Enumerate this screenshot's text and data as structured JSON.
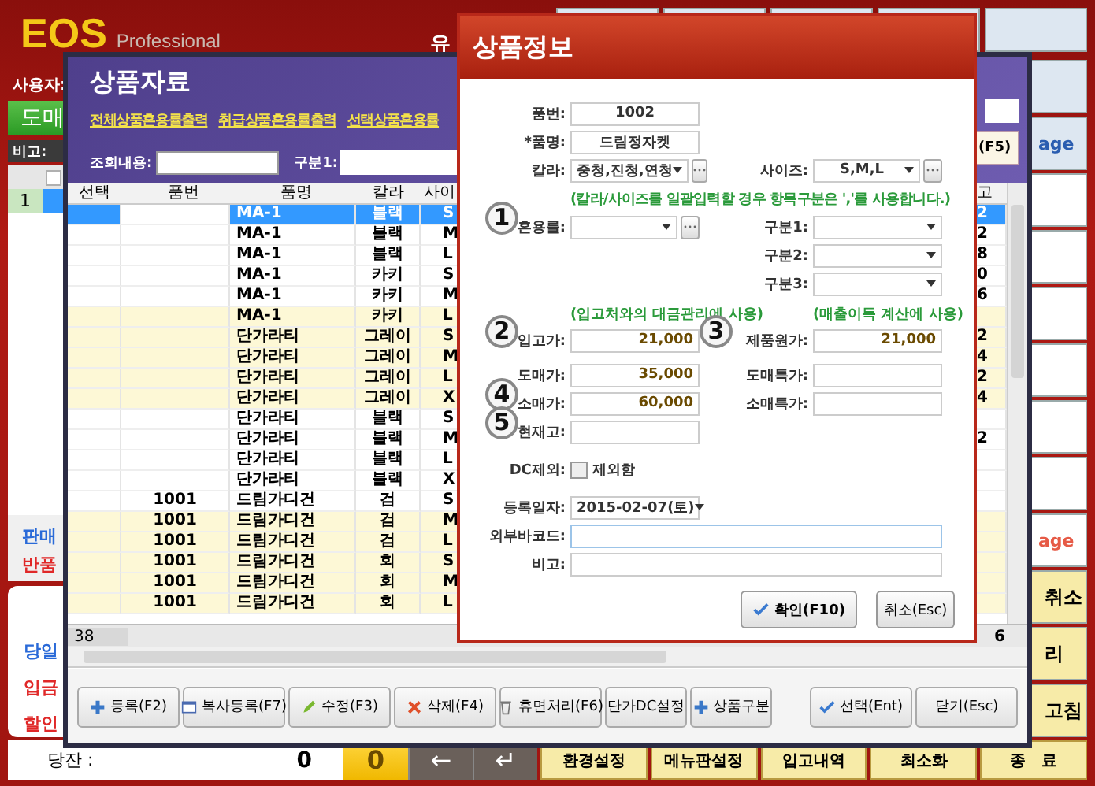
{
  "app": {
    "logo": "EOS",
    "edition": "Professional",
    "header_title": "유",
    "user_label": "사용자:",
    "mode_button": "도매",
    "memo_label": "비고:",
    "grid_row_number": "1",
    "sale_label": "판매",
    "return_label": "반품",
    "summary": [
      {
        "label": "당일",
        "color": "#2a6ad8"
      },
      {
        "label": "입금",
        "color": "#e02828"
      },
      {
        "label": "할인",
        "color": "#e02828"
      }
    ],
    "balance": {
      "label": "당잔 :",
      "value": "0"
    },
    "keypad": [
      {
        "label": "0",
        "kind": "number"
      },
      {
        "label": "←",
        "kind": "key"
      },
      {
        "label": "↵",
        "kind": "key"
      }
    ],
    "menu_buttons": [
      "환경설정",
      "메뉴판설정",
      "입고내역",
      "최소화",
      "종　료"
    ],
    "select_all_checked": false,
    "side_tiles": [
      {
        "kind": "nav"
      },
      {
        "kind": "nav",
        "label": "age",
        "color": "#2a5db0"
      },
      {
        "kind": "slot"
      },
      {
        "kind": "slot"
      },
      {
        "kind": "slot"
      },
      {
        "kind": "slot"
      },
      {
        "kind": "slot"
      },
      {
        "kind": "slot"
      },
      {
        "kind": "slot",
        "label": "age",
        "color": "#e65a46"
      },
      {
        "kind": "action",
        "label": "취소"
      },
      {
        "kind": "action",
        "label": "리"
      },
      {
        "kind": "action",
        "label": "고침"
      }
    ]
  },
  "product_list": {
    "title": "상품자료",
    "links": [
      "전체상품혼용률출력",
      "취급상품혼용률출력",
      "선택상품혼용률"
    ],
    "search_label": "조회내용:",
    "category_label": "구분1:",
    "search_button": "(F5)",
    "columns": [
      "선택",
      "품번",
      "품명",
      "칼라",
      "사이",
      "고"
    ],
    "rows": [
      {
        "name": "MA-1",
        "colorway": "블랙",
        "size": "S",
        "stock": "2",
        "selected": true,
        "highlight": false
      },
      {
        "name": "MA-1",
        "colorway": "블랙",
        "size": "M",
        "stock": "2",
        "selected": false,
        "highlight": false
      },
      {
        "name": "MA-1",
        "colorway": "블랙",
        "size": "L",
        "stock": "8",
        "selected": false,
        "highlight": false
      },
      {
        "name": "MA-1",
        "colorway": "카키",
        "size": "S",
        "stock": "0",
        "selected": false,
        "highlight": false
      },
      {
        "name": "MA-1",
        "colorway": "카키",
        "size": "M",
        "stock": "6",
        "selected": false,
        "highlight": false
      },
      {
        "name": "MA-1",
        "colorway": "카키",
        "size": "L",
        "selected": false,
        "highlight": true
      },
      {
        "name": "단가라티",
        "colorway": "그레이",
        "size": "S",
        "stock": "2",
        "selected": false,
        "highlight": true
      },
      {
        "name": "단가라티",
        "colorway": "그레이",
        "size": "M",
        "stock": "4",
        "selected": false,
        "highlight": true
      },
      {
        "name": "단가라티",
        "colorway": "그레이",
        "size": "L",
        "stock": "2",
        "selected": false,
        "highlight": true
      },
      {
        "name": "단가라티",
        "colorway": "그레이",
        "size": "X",
        "stock": "4",
        "selected": false,
        "highlight": true
      },
      {
        "name": "단가라티",
        "colorway": "블랙",
        "size": "S",
        "selected": false,
        "highlight": false
      },
      {
        "name": "단가라티",
        "colorway": "블랙",
        "size": "M",
        "stock": "2",
        "selected": false,
        "highlight": false
      },
      {
        "name": "단가라티",
        "colorway": "블랙",
        "size": "L",
        "selected": false,
        "highlight": false
      },
      {
        "name": "단가라티",
        "colorway": "블랙",
        "size": "X",
        "selected": false,
        "highlight": false
      },
      {
        "code": "1001",
        "name": "드림가디건",
        "colorway": "검",
        "size": "S",
        "selected": false,
        "highlight": false
      },
      {
        "code": "1001",
        "name": "드림가디건",
        "colorway": "검",
        "size": "M",
        "selected": false,
        "highlight": true
      },
      {
        "code": "1001",
        "name": "드림가디건",
        "colorway": "검",
        "size": "L",
        "selected": false,
        "highlight": true
      },
      {
        "code": "1001",
        "name": "드림가디건",
        "colorway": "회",
        "size": "S",
        "selected": false,
        "highlight": true
      },
      {
        "code": "1001",
        "name": "드림가디건",
        "colorway": "회",
        "size": "M",
        "selected": false,
        "highlight": true
      },
      {
        "code": "1001",
        "name": "드림가디건",
        "colorway": "회",
        "size": "L",
        "selected": false,
        "highlight": true
      }
    ],
    "row_count": "38",
    "stock_total": "6",
    "buttons": [
      {
        "label": "등록(F2)",
        "kind": "add"
      },
      {
        "label": "복사등록(F7)",
        "kind": "copy"
      },
      {
        "label": "수정(F3)",
        "kind": "edit"
      },
      {
        "label": "삭제(F4)",
        "kind": "delete"
      },
      {
        "label": "휴면처리(F6)",
        "kind": "trash"
      },
      {
        "label": "단가DC설정",
        "kind": "plain"
      },
      {
        "label": "상품구분",
        "kind": "add"
      },
      {
        "label": "선택(Ent)",
        "kind": "select"
      },
      {
        "label": "닫기(Esc)",
        "kind": "plain"
      }
    ]
  },
  "product_dialog": {
    "title": "상품정보",
    "code": {
      "label": "품번:",
      "value": "1002"
    },
    "name": {
      "label": "*품명:",
      "value": "드림정자켓"
    },
    "color": {
      "label": "칼라:",
      "value": "중청,진청,연청"
    },
    "size": {
      "label": "사이즈:",
      "value": "S,M,L"
    },
    "color_size_note": "(칼라/사이즈를 일괄입력할 경우 항목구분은 ','를 사용합니다.)",
    "blend": {
      "marker": "1",
      "label": "혼용률:"
    },
    "categories": [
      {
        "label": "구분1:"
      },
      {
        "label": "구분2:"
      },
      {
        "label": "구분3:"
      }
    ],
    "purchase_note": "(입고처와의 대금관리에 사용)",
    "cost_note": "(매출이득 계산에 사용)",
    "price_rows": [
      {
        "left": {
          "marker": "2",
          "label": "입고가:",
          "value": "21,000"
        },
        "right": {
          "marker": "3",
          "label": "제품원가:",
          "value": "21,000"
        }
      },
      {
        "left": {
          "label": "도매가:",
          "value": "35,000"
        },
        "right": {
          "label": "도매특가:"
        }
      },
      {
        "left": {
          "marker": "4",
          "label": "소매가:",
          "value": "60,000"
        },
        "right": {
          "label": "소매특가:"
        }
      },
      {
        "left": {
          "marker": "5",
          "label": "현재고:"
        }
      }
    ],
    "dc_exclude": {
      "label": "DC제외:",
      "option": "제외함",
      "checked": false
    },
    "reg_date": {
      "label": "등록일자:",
      "value": "2015-02-07(토)"
    },
    "barcode": {
      "label": "외부바코드:"
    },
    "memo": {
      "label": "비고:"
    },
    "buttons": [
      {
        "label": "확인(F10)",
        "kind": "confirm"
      },
      {
        "label": "취소(Esc)",
        "kind": "cancel"
      }
    ]
  }
}
